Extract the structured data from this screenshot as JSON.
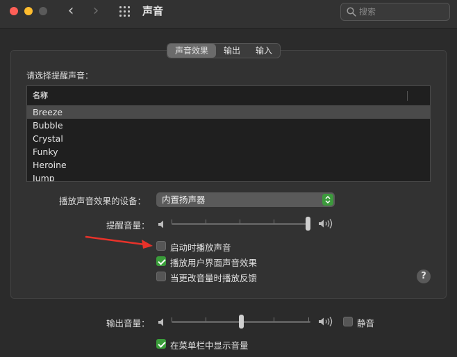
{
  "window": {
    "title": "声音"
  },
  "search": {
    "placeholder": "搜索"
  },
  "tabs": [
    {
      "label": "声音效果",
      "active": true
    },
    {
      "label": "输出",
      "active": false
    },
    {
      "label": "输入",
      "active": false
    }
  ],
  "alert_list": {
    "label": "请选择提醒声音：",
    "column": "名称",
    "items": [
      "Breeze",
      "Bubble",
      "Crystal",
      "Funky",
      "Heroine",
      "Jump"
    ],
    "selected": "Breeze"
  },
  "device": {
    "label": "播放声音效果的设备：",
    "value": "内置扬声器"
  },
  "alert_volume": {
    "label": "提醒音量：",
    "level": 1.0
  },
  "options": [
    {
      "label": "启动时播放声音",
      "checked": false
    },
    {
      "label": "播放用户界面声音效果",
      "checked": true
    },
    {
      "label": "当更改音量时播放反馈",
      "checked": false
    }
  ],
  "help": {
    "label": "?"
  },
  "output_volume": {
    "label": "输出音量：",
    "level": 0.5,
    "mute_label": "静音",
    "mute": false
  },
  "menubar": {
    "label": "在菜单栏中显示音量",
    "checked": true
  },
  "colors": {
    "accent_green": "#3a9d3a",
    "annotation_arrow": "#e8322a"
  }
}
